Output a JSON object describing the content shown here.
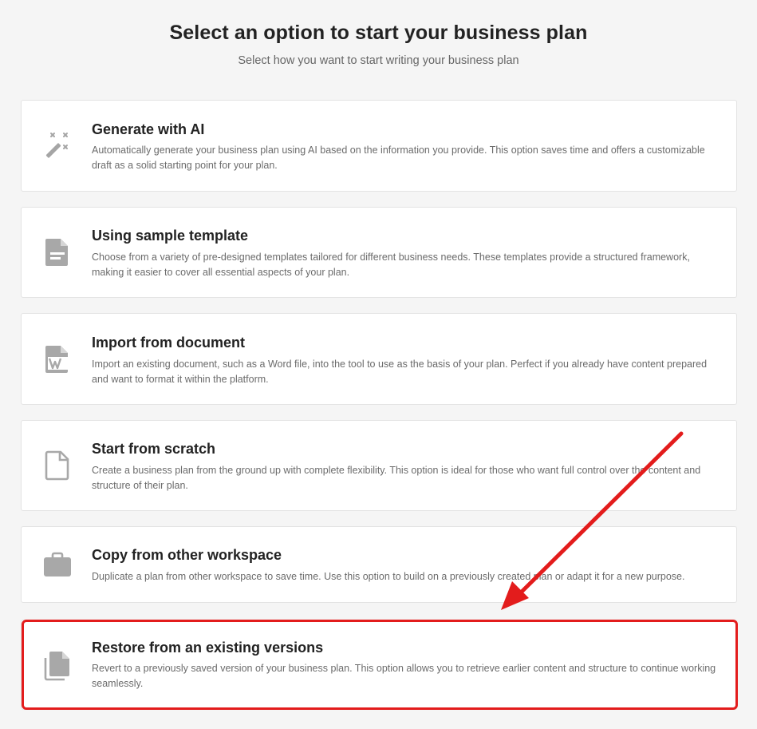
{
  "header": {
    "title": "Select an option to start your business plan",
    "subtitle": "Select how you want to start writing your business plan"
  },
  "options": [
    {
      "icon": "magic-wand-icon",
      "title": "Generate with AI",
      "description": "Automatically generate your business plan using AI based on the information you provide. This option saves time and offers a customizable draft as a solid starting point for your plan."
    },
    {
      "icon": "document-template-icon",
      "title": "Using sample template",
      "description": "Choose from a variety of pre-designed templates tailored for different business needs. These templates provide a structured framework, making it easier to cover all essential aspects of your plan."
    },
    {
      "icon": "word-document-icon",
      "title": "Import from document",
      "description": "Import an existing document, such as a Word file, into the tool to use as the basis of your plan. Perfect if you already have content prepared and want to format it within the platform."
    },
    {
      "icon": "blank-file-icon",
      "title": "Start from scratch",
      "description": "Create a business plan from the ground up with complete flexibility. This option is ideal for those who want full control over the content and structure of their plan."
    },
    {
      "icon": "briefcase-icon",
      "title": "Copy from other workspace",
      "description": "Duplicate a plan from other workspace to save time. Use this option to build on a previously created plan or adapt it for a new purpose."
    },
    {
      "icon": "copy-versions-icon",
      "title": "Restore from an existing versions",
      "description": "Revert to a previously saved version of your business plan. This option allows you to retrieve earlier content and structure to continue working seamlessly."
    }
  ],
  "colors": {
    "background": "#f5f5f5",
    "card": "#ffffff",
    "icon": "#9e9e9e",
    "annotation": "#e31c1c"
  }
}
